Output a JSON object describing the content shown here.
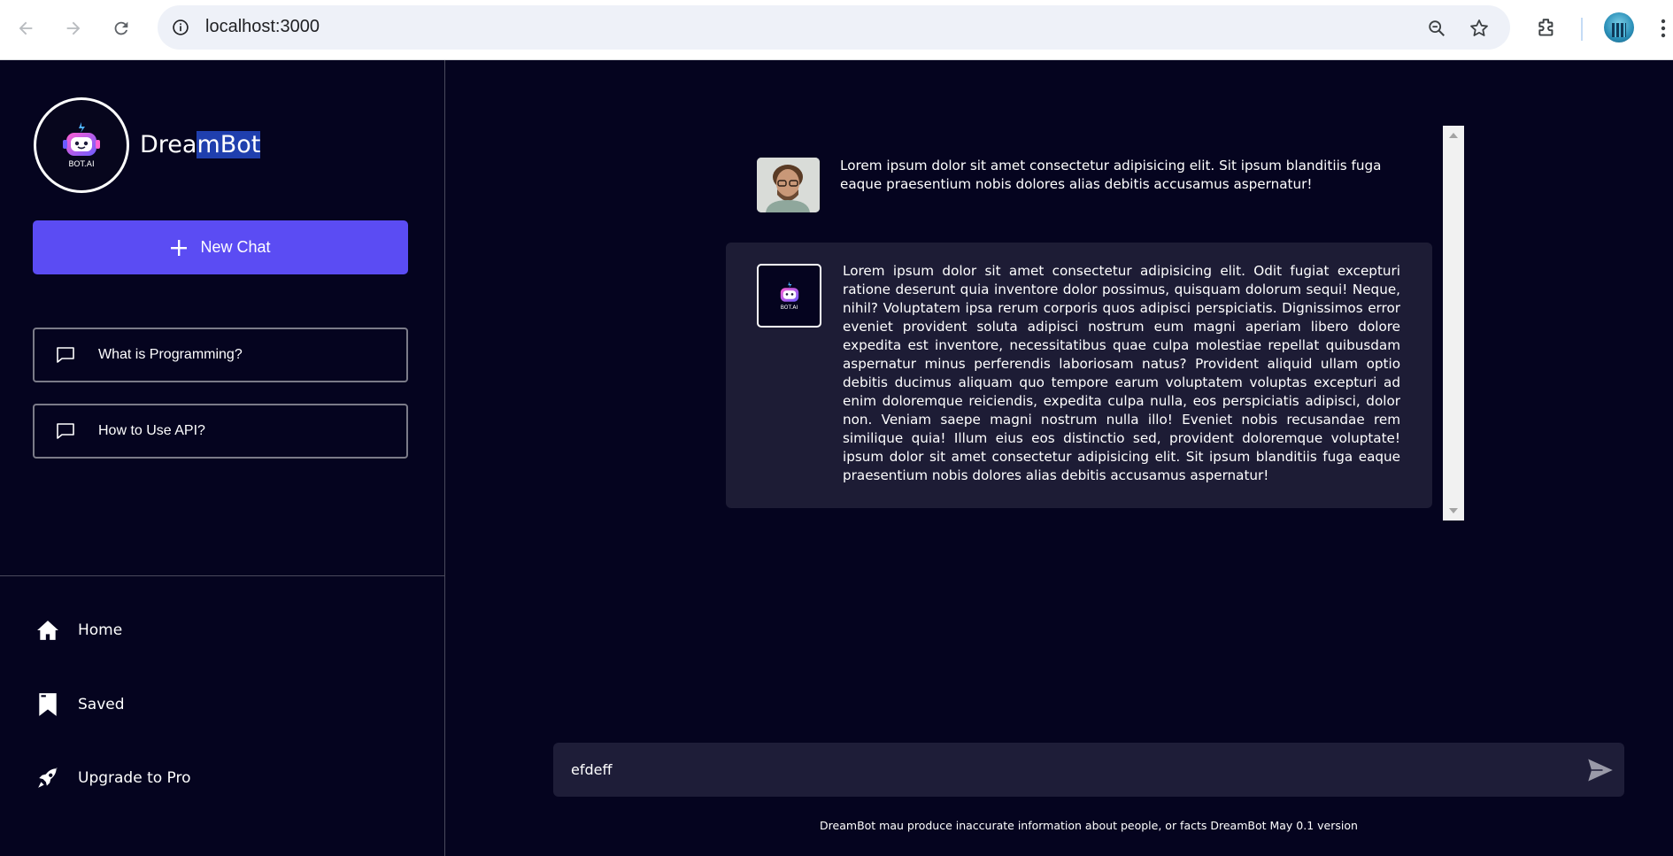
{
  "browser": {
    "url": "localhost:3000"
  },
  "sidebar": {
    "brand_prefix": "Drea",
    "brand_highlight": "mBot",
    "logo_text": "BOT.AI",
    "new_chat_label": "New Chat",
    "history": [
      {
        "label": "What is Programming?"
      },
      {
        "label": "How to Use API?"
      }
    ],
    "menu": [
      {
        "label": "Home",
        "icon": "home-icon"
      },
      {
        "label": "Saved",
        "icon": "bookmark-icon"
      },
      {
        "label": "Upgrade to Pro",
        "icon": "rocket-icon"
      }
    ]
  },
  "chat": {
    "user_message": "Lorem ipsum dolor sit amet consectetur adipisicing elit. Sit ipsum blanditiis fuga eaque praesentium nobis dolores alias debitis accusamus aspernatur!",
    "bot_avatar_text": "BOT.AI",
    "bot_message": "Lorem ipsum dolor sit amet consectetur adipisicing elit. Odit fugiat excepturi ratione deserunt quia inventore dolor possimus, quisquam dolorum sequi! Neque, nihil? Voluptatem ipsa rerum corporis quos adipisci perspiciatis. Dignissimos error eveniet provident soluta adipisci nostrum eum magni aperiam libero dolore expedita est inventore, necessitatibus quae culpa molestiae repellat quibusdam aspernatur minus perferendis laboriosam natus? Provident aliquid ullam optio debitis ducimus aliquam quo tempore earum voluptatem voluptas excepturi ad enim doloremque reiciendis, expedita culpa nulla, eos perspiciatis adipisci, dolor non. Veniam saepe magni nostrum nulla illo! Eveniet nobis recusandae rem similique quia! Illum eius eos distinctio sed, provident doloremque voluptate! ipsum dolor sit amet consectetur adipisicing elit. Sit ipsum blanditiis fuga eaque praesentium nobis dolores alias debitis accusamus aspernatur!"
  },
  "composer": {
    "value": "efdeff"
  },
  "footer": {
    "disclaimer": "DreamBot mau produce inaccurate information about people, or facts DreamBot May 0.1 version"
  },
  "colors": {
    "background": "#05041f",
    "accent": "#5b4cf3",
    "bubble": "#1d1c35"
  }
}
